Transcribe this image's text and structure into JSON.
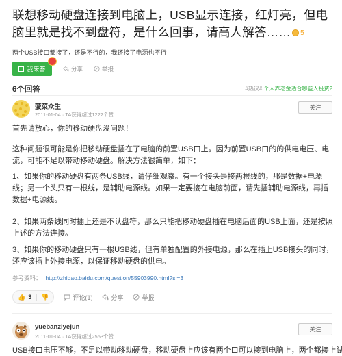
{
  "question": {
    "title": "联想移动硬盘连接到电脑上，USB显示连接，红灯亮，但电脑里就是找不到盘符，是什么回事，请高人解答……",
    "reward": "5",
    "description": "两个USB接口都接了，还是不行的，我还接了电源也不行"
  },
  "actions": {
    "answer_label": "我来答",
    "share_label": "分享",
    "report_label": "举报"
  },
  "answers_header": {
    "count_label": "6个回答",
    "hot_tag": "#热议#",
    "hot_topic": "个人养老金适合哪些人投资?"
  },
  "answers": [
    {
      "name": "菠菜众生",
      "meta": "2011-01-04 · TA获得超过1222个赞",
      "follow_label": "关注",
      "paragraphs": [
        "首先请放心，你的移动硬盘没问题！",
        "这种问题很可能是你把移动硬盘插在了电脑的前置USB口上。因为前置USB口的的供电电压、电流，可能不足以带动移动硬盘。解决方法很简单，如下：",
        "1、如果你的移动硬盘有两条USB线，请仔细观察。有一个接头是接两根线的，那是数据+电源线；另一个头只有一根线，是辅助电源线。如果一定要接在电脑前面，请先插辅助电源线，再插数据+电源线。",
        "2、如果两条线同时插上还是不认盘符，那么只能把移动硬盘插在电脑后面的USB上面，还是按照上述的方法连接。",
        "3、如果你的移动硬盘只有一根USB线，但有单独配置的外接电源，那么在插上USB接头的同时，还应该插上外接电源，以保证移动硬盘的供电。"
      ],
      "ref_label": "参考资料：",
      "ref_link": "http://zhidao.baidu.com/question/55903990.html?si=3",
      "votes": "3",
      "comment_label": "评论(1)",
      "share_label": "分享",
      "report_label": "举报"
    },
    {
      "name": "yuebanziyejun",
      "meta": "2011-01-04 · TA获得超过2553个赞",
      "follow_label": "关注",
      "first_line": "USB接口电压不够，不足以带动移动硬盘，移动硬盘上应该有两个口可以接到电脑上，两个都接上试"
    }
  ],
  "colors": {
    "accent_green": "#38b348",
    "link_blue": "#3c79b9",
    "coin_gold": "#f6b93b"
  }
}
